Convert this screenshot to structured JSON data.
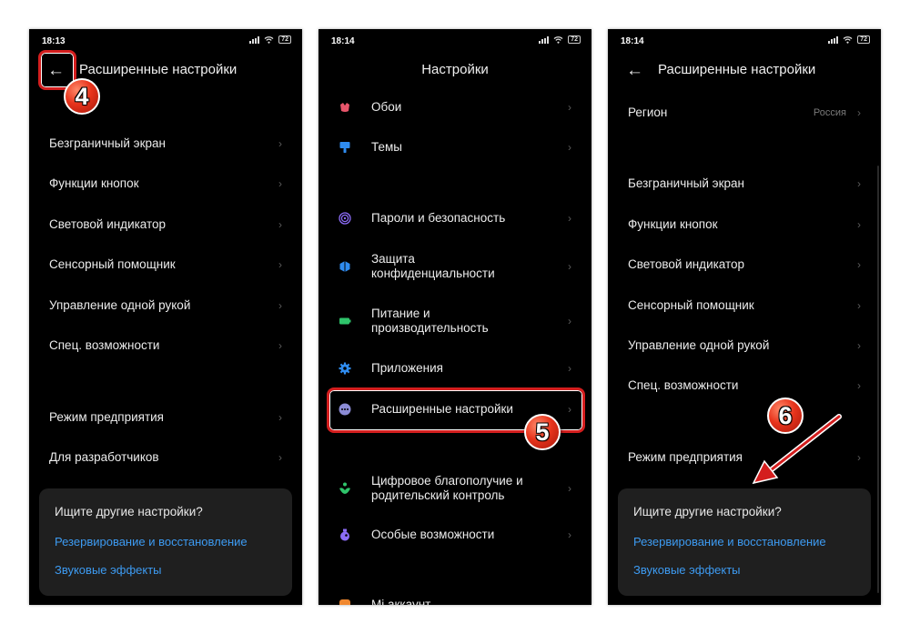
{
  "screen1": {
    "time": "18:13",
    "battery": "72",
    "title": "Расширенные настройки",
    "items": [
      "Безграничный экран",
      "Функции кнопок",
      "Световой индикатор",
      "Сенсорный помощник",
      "Управление одной рукой",
      "Спец. возможности",
      "Режим предприятия",
      "Для разработчиков"
    ],
    "search_card": {
      "question": "Ищите другие настройки?",
      "link1": "Резервирование и восстановление",
      "link2": "Звуковые эффекты"
    },
    "step_badge": "4"
  },
  "screen2": {
    "time": "18:14",
    "battery": "72",
    "title": "Настройки",
    "items": [
      {
        "label": "Обои",
        "icon": "wallpaper-icon",
        "color": "#e8556b"
      },
      {
        "label": "Темы",
        "icon": "themes-icon",
        "color": "#2f8cf0"
      },
      {
        "label": "Пароли и безопасность",
        "icon": "fingerprint-icon",
        "color": "#8c6cf6"
      },
      {
        "label": "Защита\nконфиденциальности",
        "icon": "privacy-icon",
        "color": "#2f8cf0"
      },
      {
        "label": "Питание и\nпроизводительность",
        "icon": "battery-icon",
        "color": "#2fc46b"
      },
      {
        "label": "Приложения",
        "icon": "gear-icon",
        "color": "#2f8cf0"
      },
      {
        "label": "Расширенные настройки",
        "icon": "more-icon",
        "color": "#8c8cd6"
      },
      {
        "label": "Цифровое благополучие и\nродительский контроль",
        "icon": "wellbeing-icon",
        "color": "#2fc46b"
      },
      {
        "label": "Особые возможности",
        "icon": "accessibility-icon",
        "color": "#8c6cf6"
      },
      {
        "label": "Mi аккаунт",
        "icon": "mi-account-icon",
        "color": "#f0882f"
      }
    ],
    "step_badge": "5"
  },
  "screen3": {
    "time": "18:14",
    "battery": "72",
    "title": "Расширенные настройки",
    "region_label": "Регион",
    "region_value": "Россия",
    "items": [
      "Безграничный экран",
      "Функции кнопок",
      "Световой индикатор",
      "Сенсорный помощник",
      "Управление одной рукой",
      "Спец. возможности",
      "Режим предприятия"
    ],
    "search_card": {
      "question": "Ищите другие настройки?",
      "link1": "Резервирование и восстановление",
      "link2": "Звуковые эффекты"
    },
    "step_badge": "6",
    "accent_red": "#d41e1e"
  }
}
